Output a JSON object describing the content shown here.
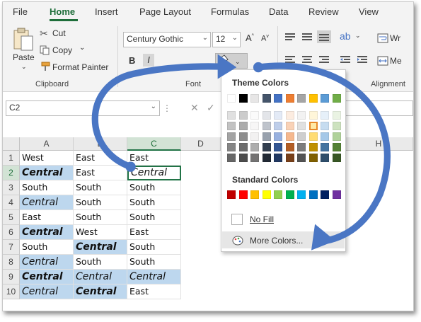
{
  "menu": [
    "File",
    "Home",
    "Insert",
    "Page Layout",
    "Formulas",
    "Data",
    "Review",
    "View"
  ],
  "clipboard": {
    "paste": "Paste",
    "cut": "Cut",
    "copy": "Copy",
    "format_painter": "Format Painter",
    "group": "Clipboard"
  },
  "font": {
    "name": "Century Gothic",
    "size": "12",
    "group": "Font"
  },
  "alignment": {
    "wrap": "Wr",
    "merge": "Me",
    "group": "Alignment"
  },
  "namebox": {
    "value": "C2"
  },
  "columns": [
    "A",
    "B",
    "C",
    "D",
    "H"
  ],
  "rows": [
    {
      "n": "1",
      "cells": [
        "West",
        "East",
        "East"
      ]
    },
    {
      "n": "2",
      "cells": [
        "Central",
        "East",
        "Central"
      ]
    },
    {
      "n": "3",
      "cells": [
        "South",
        "South",
        "South"
      ]
    },
    {
      "n": "4",
      "cells": [
        "Central",
        "South",
        "South"
      ]
    },
    {
      "n": "5",
      "cells": [
        "East",
        "South",
        "South"
      ]
    },
    {
      "n": "6",
      "cells": [
        "Central",
        "West",
        "East"
      ]
    },
    {
      "n": "7",
      "cells": [
        "South",
        "Central",
        "South"
      ]
    },
    {
      "n": "8",
      "cells": [
        "Central",
        "South",
        "South"
      ]
    },
    {
      "n": "9",
      "cells": [
        "Central",
        "Central",
        "Central"
      ]
    },
    {
      "n": "10",
      "cells": [
        "Central",
        "Central",
        "East"
      ]
    }
  ],
  "fill_menu": {
    "theme_title": "Theme Colors",
    "standard_title": "Standard Colors",
    "no_fill": "No Fill",
    "more_colors": "More Colors...",
    "theme_top": [
      "#ffffff",
      "#000000",
      "#e7e6e6",
      "#44546a",
      "#4472c4",
      "#ed7d31",
      "#a5a5a5",
      "#ffc000",
      "#5b9bd5",
      "#70ad47"
    ],
    "standard": [
      "#c00000",
      "#ff0000",
      "#ffc000",
      "#ffff00",
      "#92d050",
      "#00b050",
      "#00b0f0",
      "#0070c0",
      "#002060",
      "#7030a0"
    ]
  },
  "colors": {
    "accent": "#217346",
    "selection_blue": "#bdd7ee",
    "arrow": "#4a76c4"
  }
}
